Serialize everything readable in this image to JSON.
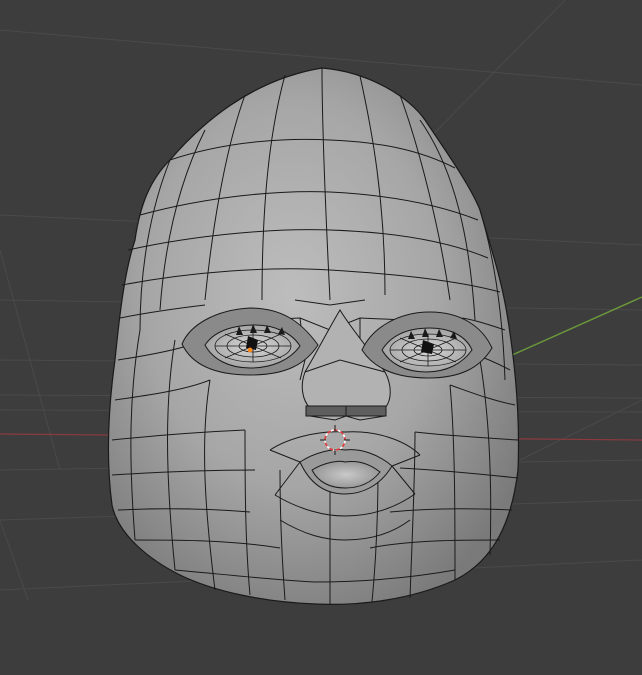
{
  "viewport": {
    "background": "#3d3d3d",
    "grid_color": "#4a4a4a",
    "x_axis_color": "#8c3a3f",
    "y_axis_color": "#6c9a3a"
  },
  "object": {
    "kind": "face-mesh",
    "shading": "solid",
    "overlay": "wireframe",
    "mesh_color": "#a8a8a8",
    "wire_color": "#1a1a1a"
  },
  "cursor_3d": {
    "icon": "3d-cursor-icon",
    "colors": [
      "#e23a3a",
      "#ffffff"
    ]
  },
  "origin": {
    "icon": "origin-dot-icon",
    "color": "#ff8a1a"
  }
}
